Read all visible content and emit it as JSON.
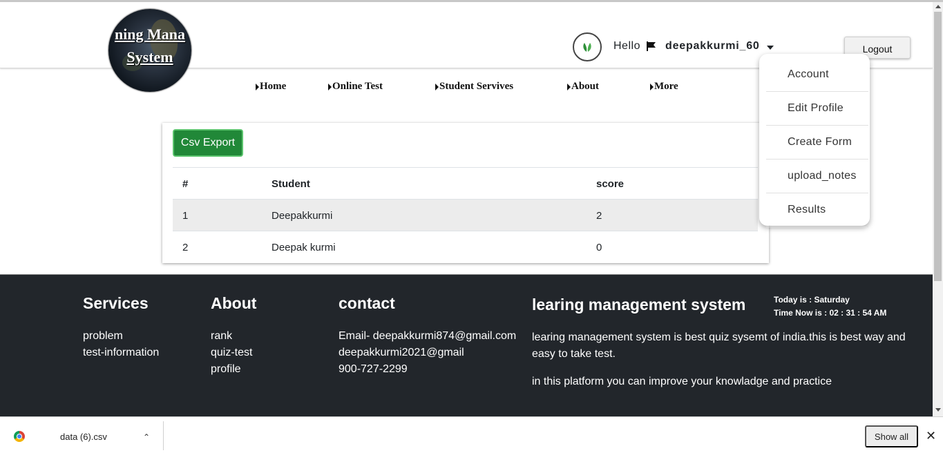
{
  "header": {
    "logo": {
      "line1": "ning Mana",
      "line2": "System"
    },
    "greeting": "Hello",
    "username": "deepakkurmi_60",
    "logout_label": "Logout"
  },
  "nav": {
    "items": [
      {
        "label": "Home"
      },
      {
        "label": "Online Test"
      },
      {
        "label": "Student Servives"
      },
      {
        "label": "About"
      },
      {
        "label": "More"
      }
    ]
  },
  "user_menu": {
    "items": [
      {
        "label": "Account"
      },
      {
        "label": "Edit Profile"
      },
      {
        "label": "Create Form"
      },
      {
        "label": "upload_notes"
      },
      {
        "label": "Results"
      }
    ]
  },
  "results": {
    "export_label": "Csv Export",
    "columns": [
      "#",
      "Student",
      "score"
    ],
    "rows": [
      [
        "1",
        "Deepakkurmi",
        "2"
      ],
      [
        "2",
        "Deepak kurmi",
        "0"
      ]
    ]
  },
  "footer": {
    "services": {
      "title": "Services",
      "links": [
        "problem",
        "test-information"
      ]
    },
    "about": {
      "title": "About",
      "links": [
        "rank",
        "quiz-test",
        "profile"
      ]
    },
    "contact": {
      "title": "contact",
      "lines": [
        "Email- deepakkurmi874@gmail.com",
        "deepakkurmi2021@gmail",
        "900-727-2299"
      ]
    },
    "lms": {
      "title": "learing management system",
      "today": "Today is : Saturday",
      "time": "Time Now is : 02 : 31 : 54 AM",
      "para1": "learing management system is best quiz sysemt of india.this is best way and easy to take test.",
      "para2": "in this platform you can improve your knowladge and practice"
    }
  },
  "download_bar": {
    "file_name": "data (6).csv",
    "show_all_label": "Show all"
  },
  "colors": {
    "footer_bg": "#22262b",
    "export_button": "#218838"
  }
}
